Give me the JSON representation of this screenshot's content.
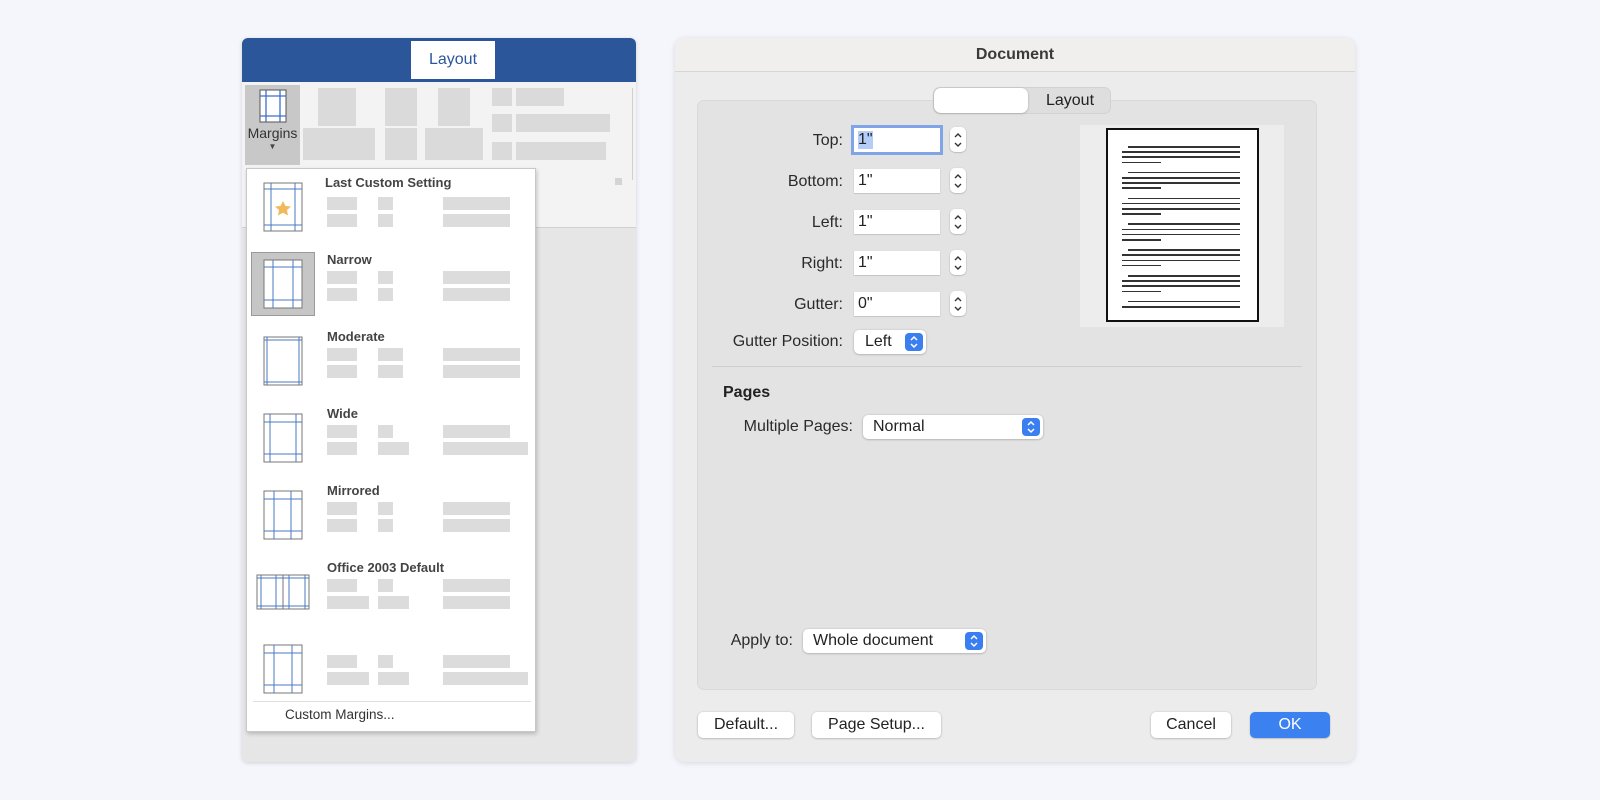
{
  "word_panel": {
    "active_tab": "Layout",
    "margins_button": {
      "label": "Margins",
      "icon": "margins-icon"
    },
    "dropdown": {
      "presets": [
        {
          "label": "Last Custom Setting",
          "icon": "last-custom-margins-icon",
          "selected": false,
          "has_star": true
        },
        {
          "label": "Narrow",
          "icon": "narrow-margins-icon",
          "selected": true
        },
        {
          "label": "Moderate",
          "icon": "moderate-margins-icon",
          "selected": false
        },
        {
          "label": "Wide",
          "icon": "wide-margins-icon",
          "selected": false
        },
        {
          "label": "Mirrored",
          "icon": "mirrored-margins-icon",
          "selected": false
        },
        {
          "label": "Office 2003 Default",
          "icon": "office-2003-margins-icon",
          "selected": false
        },
        {
          "label": "",
          "icon": "unnamed-margins-icon",
          "selected": false
        }
      ],
      "custom_margins_label": "Custom Margins..."
    }
  },
  "dialog": {
    "title": "Document",
    "segmented": {
      "first_label": "",
      "second_label": "Layout"
    },
    "margins": {
      "top": {
        "label": "Top:",
        "value": "1\"",
        "focused": true
      },
      "bottom": {
        "label": "Bottom:",
        "value": "1\""
      },
      "left": {
        "label": "Left:",
        "value": "1\""
      },
      "right": {
        "label": "Right:",
        "value": "1\""
      },
      "gutter": {
        "label": "Gutter:",
        "value": "0\""
      }
    },
    "gutter_position": {
      "label": "Gutter Position:",
      "value": "Left"
    },
    "pages": {
      "section_title": "Pages",
      "multiple_pages": {
        "label": "Multiple Pages:",
        "value": "Normal"
      }
    },
    "apply_to": {
      "label": "Apply to:",
      "value": "Whole document"
    },
    "buttons": {
      "default": "Default...",
      "page_setup": "Page Setup...",
      "cancel": "Cancel",
      "ok": "OK"
    },
    "accent_color": "#3b82f0"
  }
}
